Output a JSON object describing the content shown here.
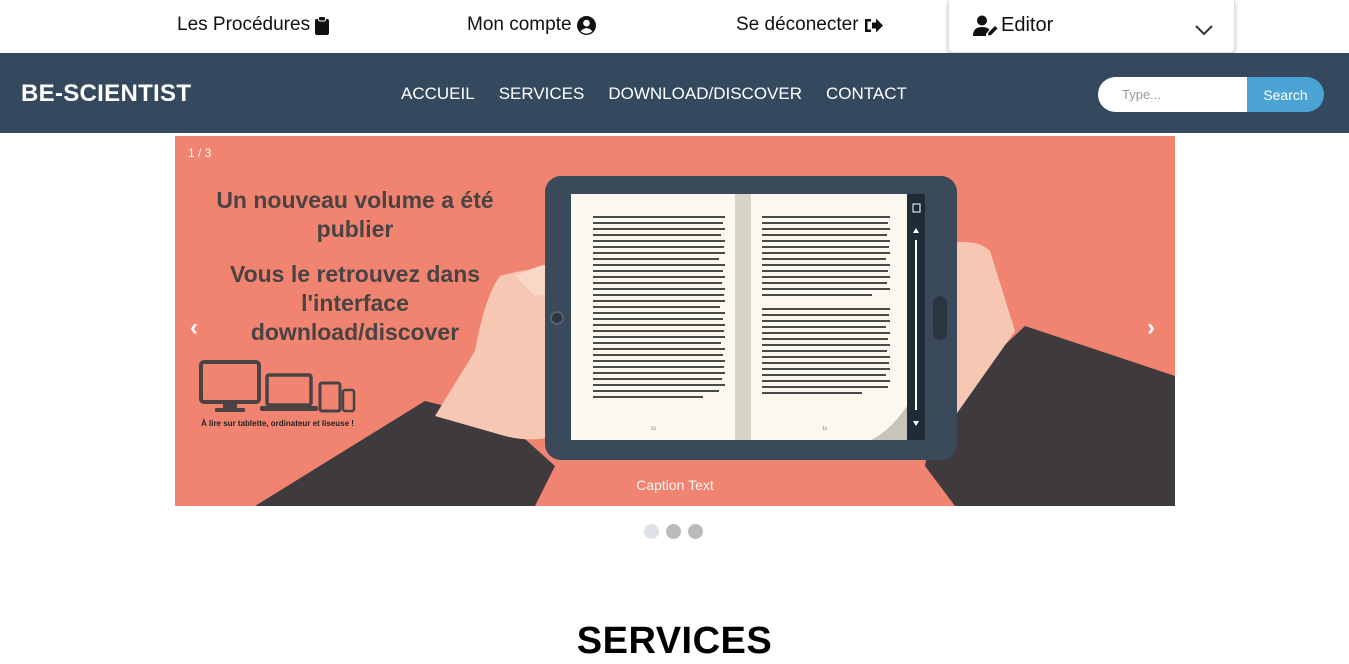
{
  "topbar": {
    "procedures_label": "Les Procédures",
    "account_label": "Mon compte",
    "logout_label": "Se déconecter",
    "editor_label": "Editor"
  },
  "navbar": {
    "brand": "BE-SCIENTIST",
    "links": [
      "ACCUEIL",
      "SERVICES",
      "DOWNLOAD/DISCOVER",
      "CONTACT"
    ],
    "search_placeholder": "Type...",
    "search_button": "Search",
    "bg_color": "#34495e",
    "accent_color": "#4aa3d4"
  },
  "slideshow": {
    "slide_number": "1 / 3",
    "headline_1": "Un nouveau volume a été",
    "headline_2": "publier",
    "subline_1": "Vous le retrouvez dans",
    "subline_2": "l'interface",
    "subline_3": "download/discover",
    "devices_caption": "À lire sur tablette, ordinateur et liseuse !",
    "caption": "Caption Text",
    "prev_symbol": "‹",
    "next_symbol": "›",
    "bg_color": "#f08470",
    "total_slides": 3,
    "active_slide": 1,
    "book_page_left": "32",
    "book_page_right": "33"
  },
  "services": {
    "title": "SERVICES"
  }
}
